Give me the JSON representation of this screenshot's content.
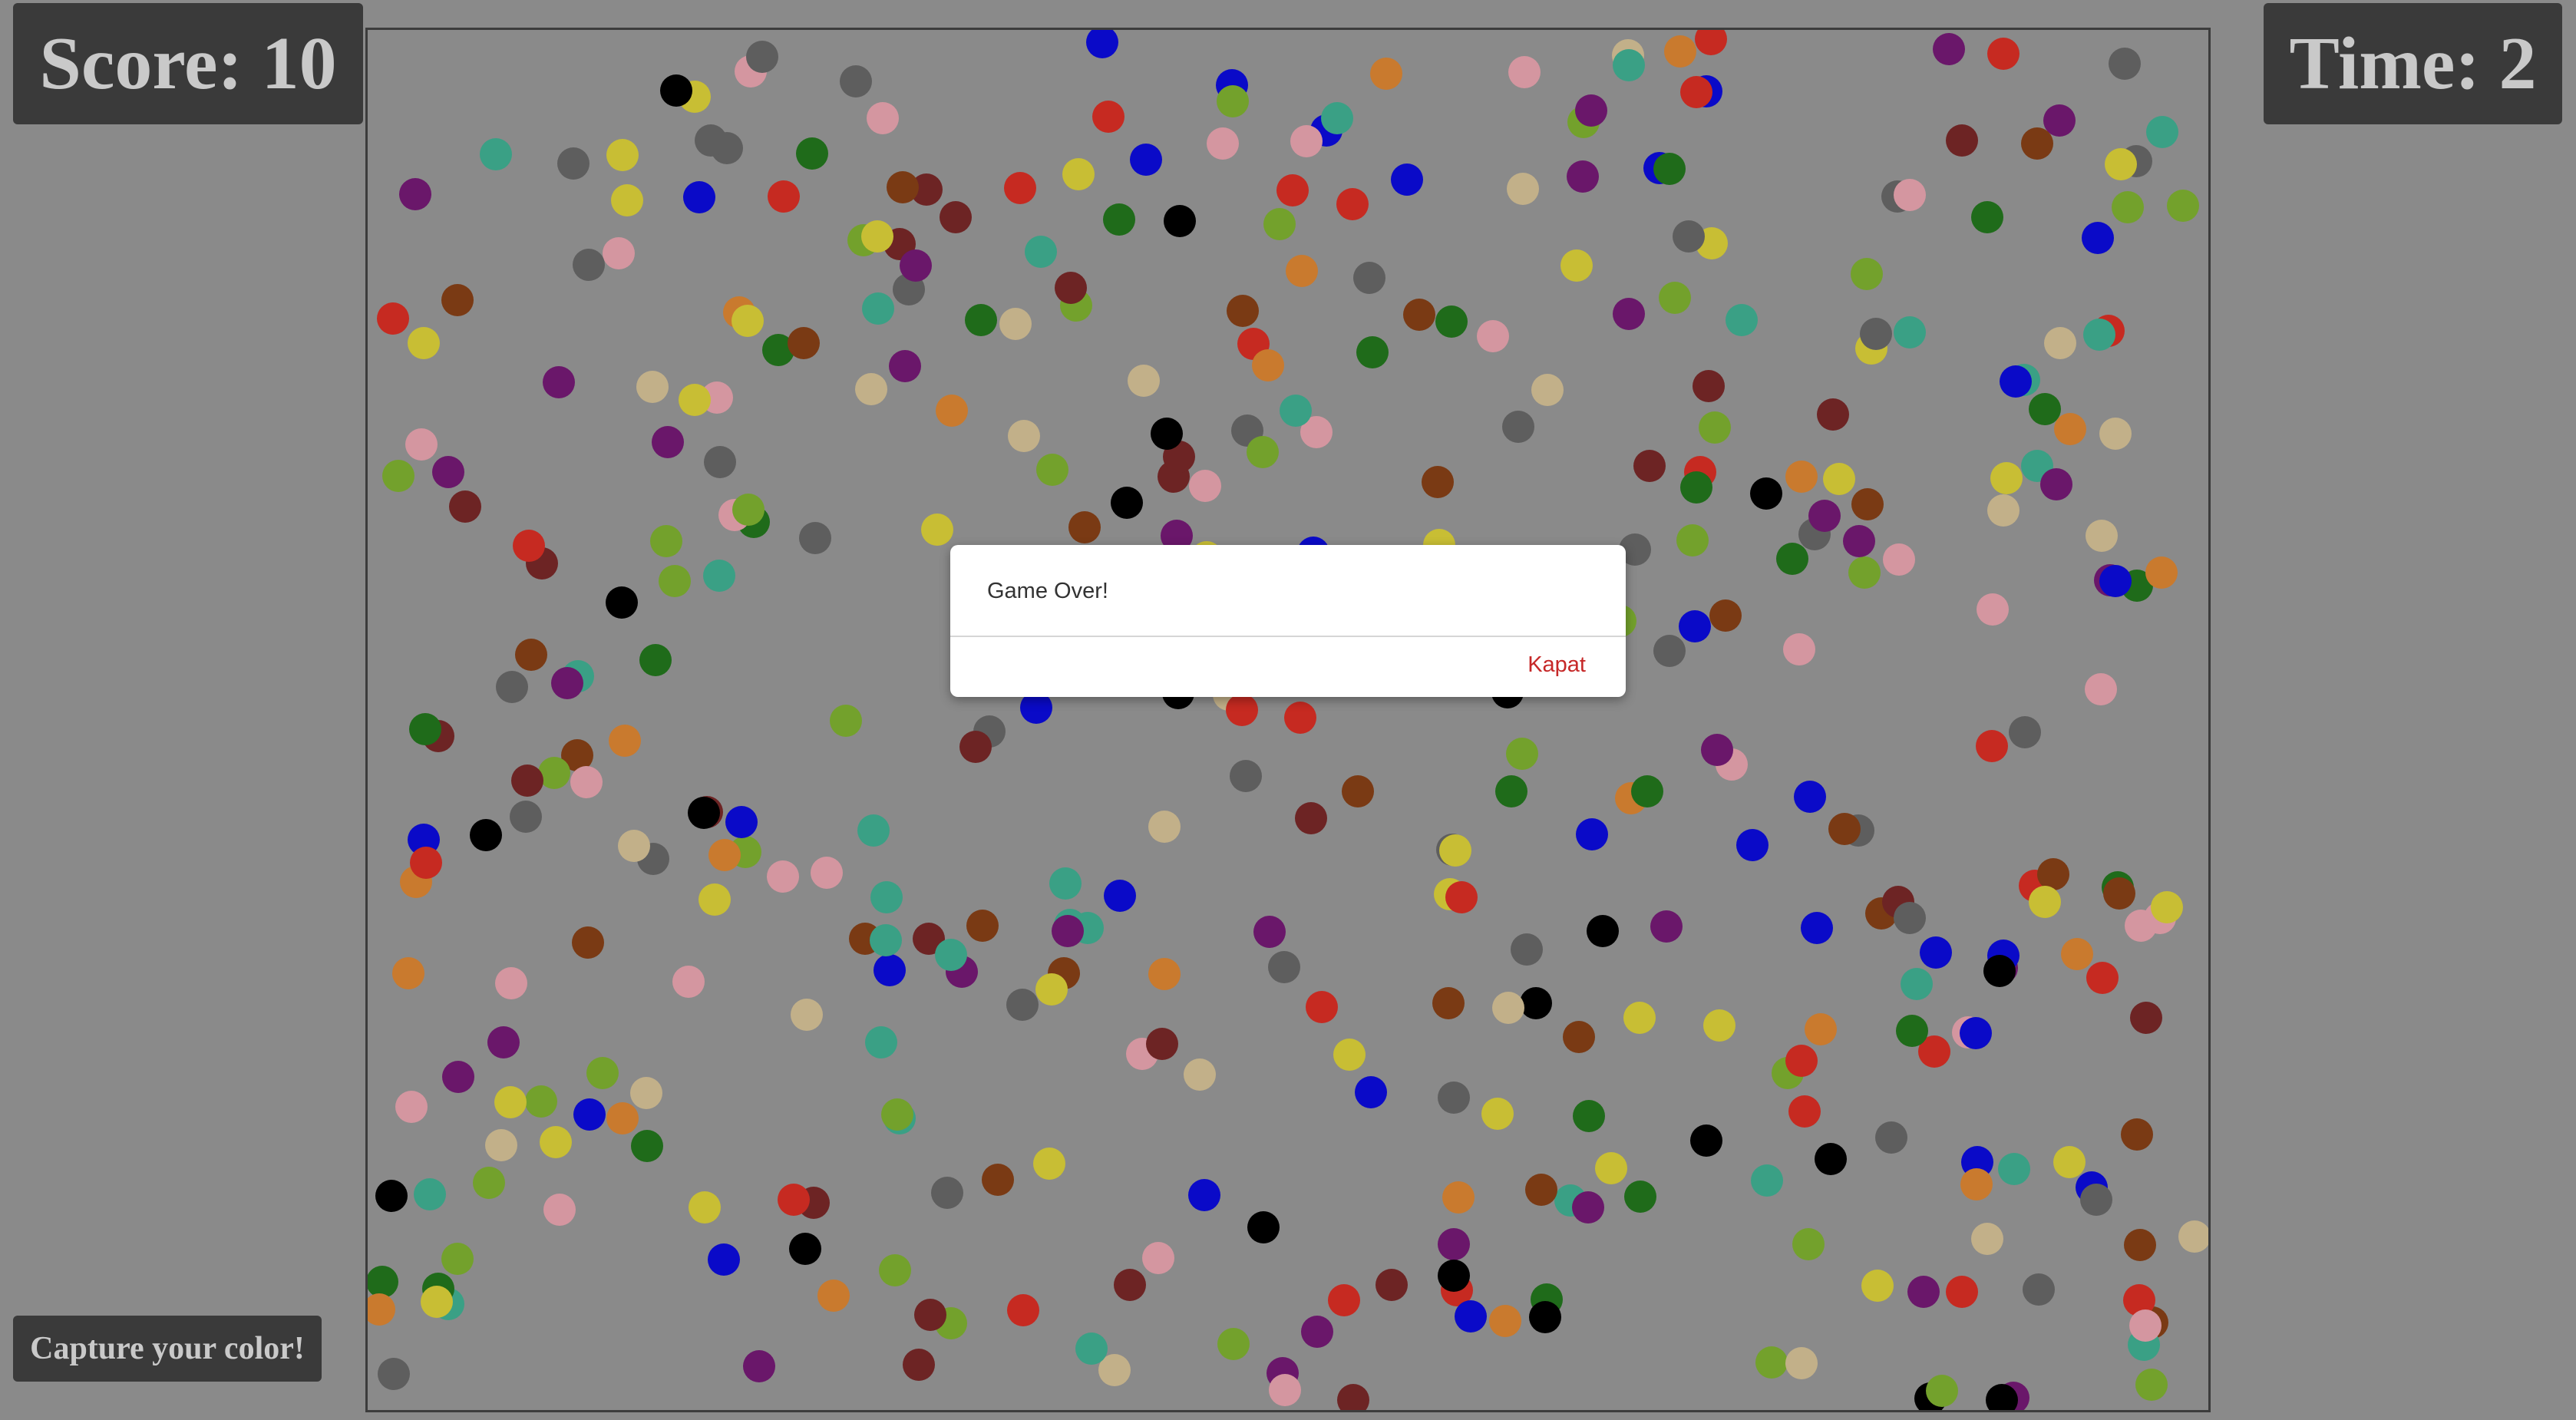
{
  "hud": {
    "score_label": "Score: 10",
    "time_label": "Time: 2",
    "capture_label": "Capture your color!"
  },
  "dialog": {
    "message": "Game Over!",
    "close_label": "Kapat",
    "close_color": "#c62828"
  },
  "colors": {
    "background": "#8a8a8a",
    "hud_bg": "#3a3a3a",
    "hud_text": "#c9c9c9"
  },
  "dot_palette": [
    "#c62a21",
    "#1f6b1a",
    "#6a176a",
    "#5e5e5e",
    "#c97a2e",
    "#7a3a14",
    "#c8be34",
    "#0a0ac8",
    "#3aa085",
    "#73a12c",
    "#000000",
    "#6d2424",
    "#d496a0",
    "#c2b089"
  ]
}
